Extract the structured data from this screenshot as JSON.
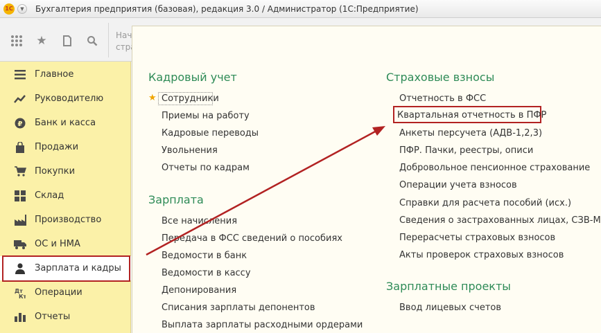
{
  "window": {
    "logo": "1С",
    "title": "Бухгалтерия предприятия (базовая), редакция 3.0 / Администратор  (1С:Предприятие)"
  },
  "toolbar": {
    "hint_line1": "Нач",
    "hint_line2": "стра",
    "icons": [
      "apps-grid-icon",
      "star-icon",
      "history-icon",
      "search-icon"
    ]
  },
  "sidebar": {
    "items": [
      {
        "label": "Главное",
        "icon": "menu-lines-icon"
      },
      {
        "label": "Руководителю",
        "icon": "trend-chart-icon"
      },
      {
        "label": "Банк и касса",
        "icon": "ruble-coin-icon"
      },
      {
        "label": "Продажи",
        "icon": "shopping-bag-icon"
      },
      {
        "label": "Покупки",
        "icon": "shopping-cart-icon"
      },
      {
        "label": "Склад",
        "icon": "warehouse-grid-icon"
      },
      {
        "label": "Производство",
        "icon": "factory-icon"
      },
      {
        "label": "ОС и НМА",
        "icon": "truck-icon"
      },
      {
        "label": "Зарплата и кадры",
        "icon": "person-icon"
      },
      {
        "label": "Операции",
        "icon": "debit-credit-icon"
      },
      {
        "label": "Отчеты",
        "icon": "bar-chart-icon"
      }
    ],
    "active_index": 8
  },
  "panel": {
    "hr_section": {
      "title": "Кадровый учет",
      "links": [
        "Сотрудники",
        "Приемы на работу",
        "Кадровые переводы",
        "Увольнения",
        "Отчеты по кадрам"
      ]
    },
    "salary_section": {
      "title": "Зарплата",
      "links": [
        "Все начисления",
        "Передача в ФСС сведений о пособиях",
        "Ведомости в банк",
        "Ведомости в кассу",
        "Депонирования",
        "Списания зарплаты депонентов",
        "Выплата зарплаты расходными ордерами"
      ]
    },
    "insurance_section": {
      "title": "Страховые взносы",
      "links": [
        "Отчетность в ФСС",
        "Квартальная отчетность в ПФР",
        "Анкеты персучета (АДВ-1,2,3)",
        "ПФР. Пачки, реестры, описи",
        "Добровольное пенсионное страхование",
        "Операции учета взносов",
        "Справки для расчета пособий (исх.)",
        "Сведения о застрахованных лицах, СЗВ-М",
        "Перерасчеты страховых взносов",
        "Акты проверок страховых взносов"
      ]
    },
    "payroll_section": {
      "title": "Зарплатные проекты",
      "links": [
        "Ввод лицевых счетов"
      ]
    }
  },
  "colors": {
    "sidebar_bg": "#fbf1a8",
    "section_title": "#2e8b57",
    "highlight": "#b22222",
    "favorite_star": "#f0a500"
  }
}
